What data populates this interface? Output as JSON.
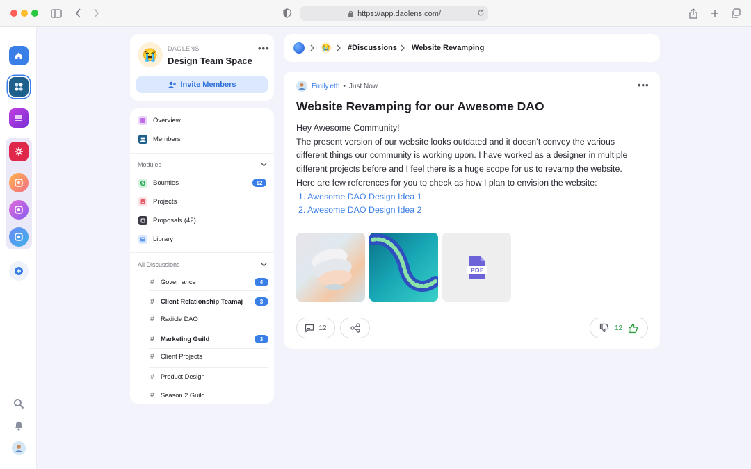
{
  "browser": {
    "url": "https://app.daolens.com/"
  },
  "space": {
    "org": "DAOLENS",
    "name": "Design Team Space",
    "invite_label": "Invite Members"
  },
  "nav": {
    "overview": "Overview",
    "members": "Members"
  },
  "modules": {
    "heading": "Modules",
    "items": [
      {
        "label": "Bounties",
        "badge": "12"
      },
      {
        "label": "Projects"
      },
      {
        "label": "Proposals (42)"
      },
      {
        "label": "Library"
      }
    ]
  },
  "discussions": {
    "heading": "All Discussions",
    "channels": [
      {
        "label": "Governance",
        "badge": "4"
      },
      {
        "label": "Client Relationship Teamaj",
        "badge": "3"
      },
      {
        "label": "Radicle DAO"
      },
      {
        "label": "Marketing Guild",
        "badge": "3"
      },
      {
        "label": "Client Projects"
      },
      {
        "label": "Product Design"
      },
      {
        "label": "Season 2 Guild"
      }
    ]
  },
  "breadcrumb": {
    "channel": "#Discussions",
    "current": "Website Revamping"
  },
  "post": {
    "author": "Emily.eth",
    "separator": "•",
    "time": "Just Now",
    "title": "Website Revamping for our Awesome DAO",
    "lines": [
      "Hey Awesome Community!",
      "The present version of our website looks outdated and it doesn’t convey the various",
      "different things our community is working upon. I have worked as a designer in multiple",
      "different projects before and I feel there is a huge scope for us to revamp the website.",
      "Here are few references for you to check as how I plan to envision the website:"
    ],
    "links": [
      "1.  Awesome DAO Design Idea 1",
      "2.  Awesome DAO Design Idea 2"
    ],
    "comment_count": "12",
    "like_count": "12"
  },
  "colors": {
    "accent": "#3a7ee8",
    "app_bg": "#f3f3fb",
    "like": "#2ea043"
  }
}
